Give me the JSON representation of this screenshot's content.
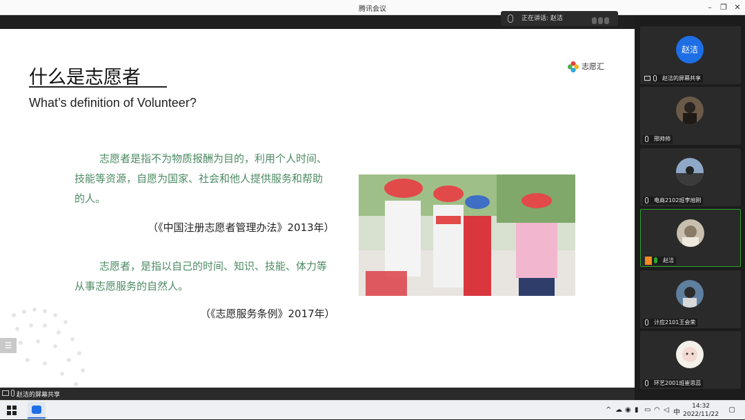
{
  "window": {
    "title": "腾讯会议"
  },
  "speaking": {
    "label": "正在讲话: 赵洁"
  },
  "slide": {
    "title_cn": "什么是志愿者",
    "title_en": "What’s definition of Volunteer?",
    "logo_text": "志愿汇",
    "para1": [
      "志愿者是指不为物质报酬为目的，利用个人时间、",
      "技能等资源，自愿为国家、社会和他人提供服务和帮助",
      "的人。"
    ],
    "source1": "（《中国注册志愿者管理办法》2013年）",
    "para2": [
      "志愿者，是指以自己的时间、知识、技能、体力等",
      "从事志愿服务的自然人。"
    ],
    "source2": "（《志愿服务条例》2017年）"
  },
  "sharebar": {
    "label": "赵洁的屏幕共享"
  },
  "participants": [
    {
      "name": "赵洁的屏幕共享",
      "avatar_text": "赵洁",
      "kind": "screen"
    },
    {
      "name": "邢帅帅",
      "kind": "photo"
    },
    {
      "name": "电商2102班李旭刚",
      "kind": "photo"
    },
    {
      "name": "赵洁",
      "kind": "photo",
      "active": true
    },
    {
      "name": "计应2101王会荣",
      "kind": "photo"
    },
    {
      "name": "环艺2001班崔思蕊",
      "kind": "photo"
    }
  ],
  "taskbar": {
    "ime": "中",
    "time": "14:32",
    "date": "2022/11/22"
  },
  "colors": {
    "para_green": "#4c8a63",
    "accent_blue": "#1e6fe6",
    "active_green": "#2ea52e"
  }
}
